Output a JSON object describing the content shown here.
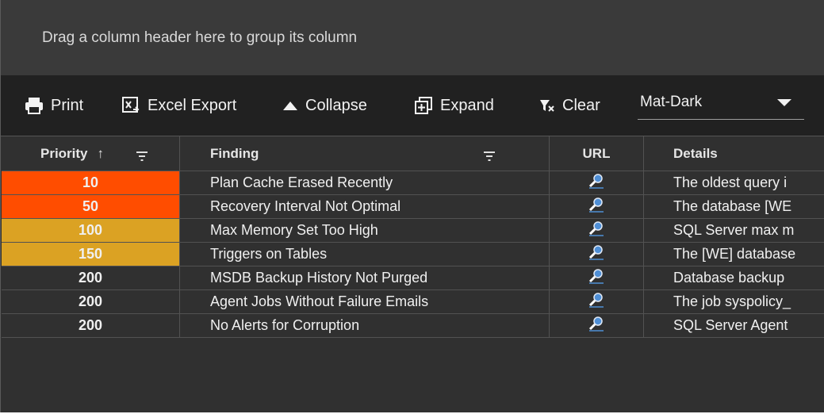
{
  "group_panel": {
    "hint": "Drag a column header here to group its column"
  },
  "toolbar": {
    "print_label": "Print",
    "excel_label": "Excel Export",
    "collapse_label": "Collapse",
    "expand_label": "Expand",
    "clear_label": "Clear",
    "theme_value": "Mat-Dark"
  },
  "columns": {
    "priority": "Priority",
    "priority_sort": "↑",
    "finding": "Finding",
    "url": "URL",
    "details": "Details"
  },
  "colors": {
    "priority_high": "#ff4d00",
    "priority_medium": "#dba223",
    "background": "#303030",
    "toolbar": "#212121"
  },
  "rows": [
    {
      "priority": "10",
      "level": "red",
      "finding": "Plan Cache Erased Recently",
      "details": "The oldest query i"
    },
    {
      "priority": "50",
      "level": "red",
      "finding": "Recovery Interval Not Optimal",
      "details": "The database [WE"
    },
    {
      "priority": "100",
      "level": "amber",
      "finding": "Max Memory Set Too High",
      "details": "SQL Server max m"
    },
    {
      "priority": "150",
      "level": "amber",
      "finding": "Triggers on Tables",
      "details": "The [WE] database"
    },
    {
      "priority": "200",
      "level": "none",
      "finding": "MSDB Backup History Not Purged",
      "details": "Database backup"
    },
    {
      "priority": "200",
      "level": "none",
      "finding": "Agent Jobs Without Failure Emails",
      "details": "The job syspolicy_"
    },
    {
      "priority": "200",
      "level": "none",
      "finding": "No Alerts for Corruption",
      "details": "SQL Server Agent"
    }
  ]
}
